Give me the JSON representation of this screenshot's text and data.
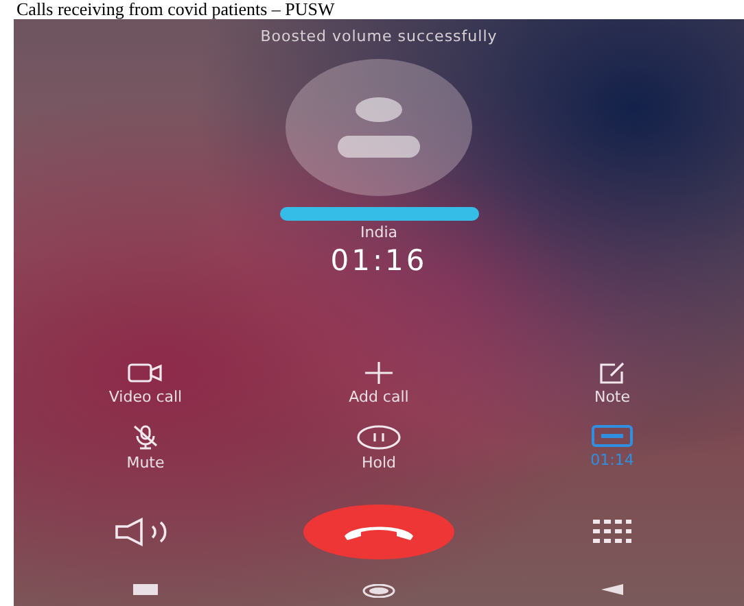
{
  "document_heading": "Calls receiving from covid patients – PUSW",
  "toast": "Boosted volume successfully",
  "caller": {
    "location": "India",
    "timer": "01:16"
  },
  "actions": [
    {
      "kind": "video",
      "label": "Video call",
      "active": false
    },
    {
      "kind": "add",
      "label": "Add call",
      "active": false
    },
    {
      "kind": "note",
      "label": "Note",
      "active": false
    },
    {
      "kind": "mute",
      "label": "Mute",
      "active": false
    },
    {
      "kind": "hold",
      "label": "Hold",
      "active": false
    },
    {
      "kind": "record",
      "label": "01:14",
      "active": true
    }
  ],
  "bottom": [
    {
      "kind": "speaker"
    },
    {
      "kind": "end"
    },
    {
      "kind": "keypad"
    }
  ],
  "nav": [
    {
      "kind": "recents"
    },
    {
      "kind": "home"
    },
    {
      "kind": "back"
    }
  ]
}
